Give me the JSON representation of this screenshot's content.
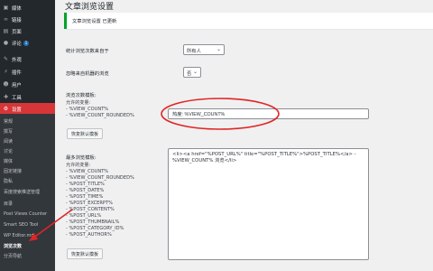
{
  "sidebar": {
    "items": [
      {
        "label": "媒体",
        "icon": "media-icon"
      },
      {
        "label": "链接",
        "icon": "link-icon"
      },
      {
        "label": "页面",
        "icon": "page-icon"
      },
      {
        "label": "评论",
        "icon": "comment-icon",
        "badge": "1"
      },
      {
        "label": "外观",
        "icon": "brush-icon"
      },
      {
        "label": "插件",
        "icon": "plugin-icon"
      },
      {
        "label": "用户",
        "icon": "user-icon"
      },
      {
        "label": "工具",
        "icon": "wrench-icon"
      },
      {
        "label": "设置",
        "icon": "settings-icon"
      }
    ],
    "submenu": [
      "常规",
      "撰写",
      "阅读",
      "讨论",
      "媒体",
      "固定链接",
      "隐私",
      "百度搜索推送管理",
      "目录",
      "Post Views Counter",
      "Smart SEO Tool",
      "WP Editor.md",
      "浏览次数",
      "分页导航"
    ]
  },
  "page": {
    "title": "文章浏览设置",
    "notice": "文章浏览设置 已更新"
  },
  "form": {
    "count_self_label": "统计浏览次数来自于",
    "count_self_value": "所有人",
    "exclude_bots_label": "忽略来自机器的浏览",
    "exclude_bots_value": "否",
    "views_template_label": "浏览次数模板:",
    "views_help": "允许的变量:\n- %VIEW_COUNT%\n- %VIEW_COUNT_ROUNDED%",
    "views_template_value": "热度: %VIEW_COUNT%",
    "restore_default": "恢复默认模板",
    "most_viewed_label": "最多浏览模板:",
    "most_viewed_help": "允许的变量:\n- %VIEW_COUNT%\n- %VIEW_COUNT_ROUNDED%\n- %POST_TITLE%\n- %POST_DATE%\n- %POST_TIME%\n- %POST_EXCERPT%\n- %POST_CONTENT%\n- %POST_URL%\n- %POST_THUMBNAIL%\n- %POST_CATEGORY_ID%\n- %POST_AUTHOR%",
    "most_viewed_value": "<li><a href=\"%POST_URL%\" title=\"%POST_TITLE%\">%POST_TITLE%</a> - %VIEW_COUNT% 浏览</li>",
    "restore_default_2": "恢复默认模板"
  },
  "colors": {
    "sidebar_bg": "#23282d",
    "current_menu": "#d63638",
    "annotation": "#e02424",
    "notice_border": "#00a32a"
  }
}
